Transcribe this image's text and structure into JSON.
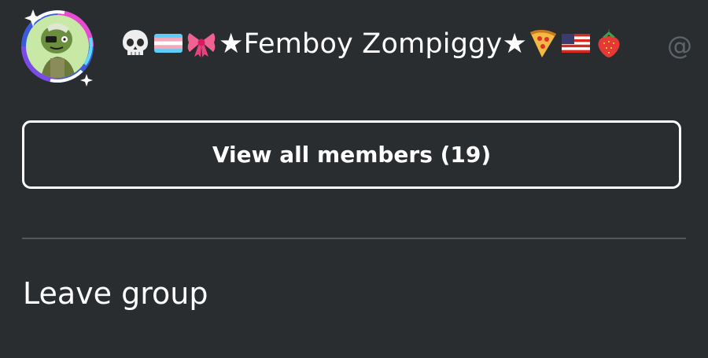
{
  "member": {
    "name_prefix_emoji": [
      "skull-emoji",
      "transgender-flag-emoji",
      "ribbon-emoji"
    ],
    "name_text": "★Femboy Zompiggy★",
    "name_suffix_emoji": [
      "pizza-emoji",
      "us-flag-emoji",
      "strawberry-emoji"
    ],
    "handle": "@"
  },
  "view_members_label": "View all members (19)",
  "leave_group_label": "Leave group",
  "colors": {
    "background": "#2a2d30",
    "text": "#ffffff",
    "divider": "#53575b",
    "muted": "#5f6468"
  }
}
